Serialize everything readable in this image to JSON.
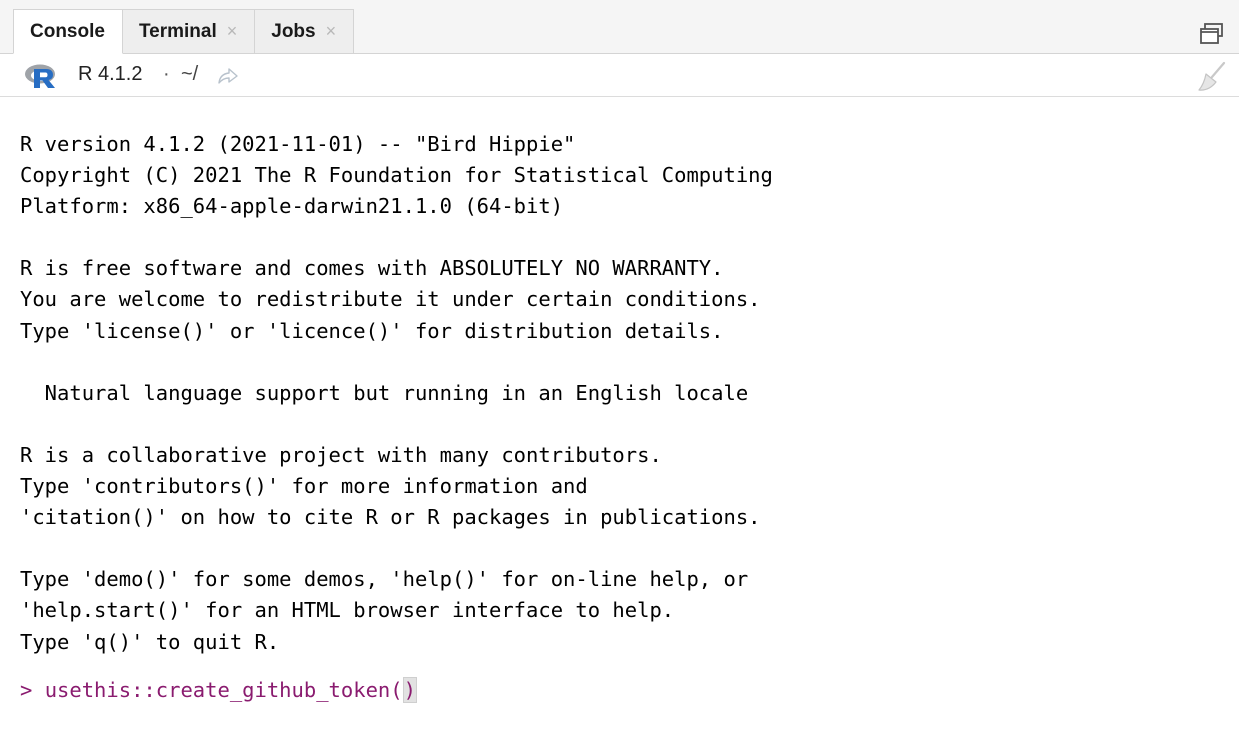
{
  "tabs": [
    {
      "label": "Console",
      "active": true,
      "closable": false
    },
    {
      "label": "Terminal",
      "active": false,
      "closable": true
    },
    {
      "label": "Jobs",
      "active": false,
      "closable": true
    }
  ],
  "tab_close_glyph": "×",
  "toolbar": {
    "r_version": "R 4.1.2",
    "separator": "·",
    "working_dir": "~/",
    "icons": [
      "r-logo-icon",
      "go-to-directory-icon",
      "clear-console-icon",
      "maximize-pane-icon"
    ]
  },
  "console": {
    "lines": [
      "R version 4.1.2 (2021-11-01) -- \"Bird Hippie\"",
      "Copyright (C) 2021 The R Foundation for Statistical Computing",
      "Platform: x86_64-apple-darwin21.1.0 (64-bit)",
      "",
      "R is free software and comes with ABSOLUTELY NO WARRANTY.",
      "You are welcome to redistribute it under certain conditions.",
      "Type 'license()' or 'licence()' for distribution details.",
      "",
      "  Natural language support but running in an English locale",
      "",
      "R is a collaborative project with many contributors.",
      "Type 'contributors()' for more information and",
      "'citation()' on how to cite R or R packages in publications.",
      "",
      "Type 'demo()' for some demos, 'help()' for on-line help, or",
      "'help.start()' for an HTML browser interface to help.",
      "Type 'q()' to quit R."
    ],
    "prompt": "> ",
    "input_text": "usethis::create_github_token",
    "input_open_paren": "(",
    "input_close_paren": ")"
  },
  "colors": {
    "prompt": "#8a1b6f",
    "r_logo_blue": "#276dc3",
    "r_logo_grey": "#9fa3a8"
  }
}
